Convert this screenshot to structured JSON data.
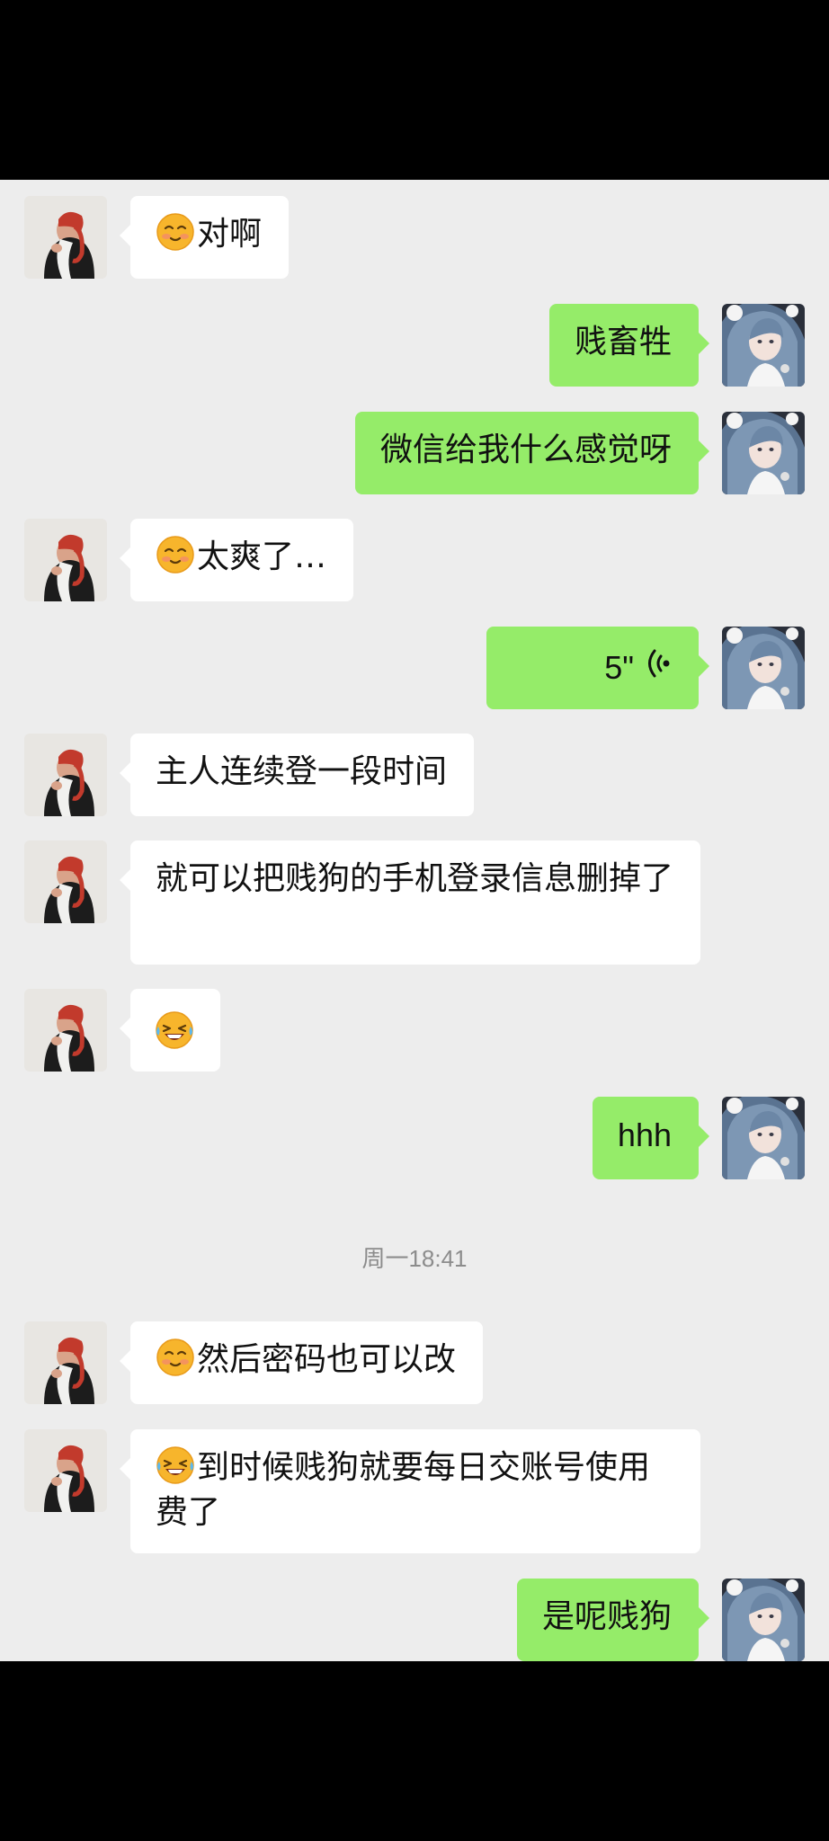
{
  "messages": [
    {
      "id": "m1",
      "side": "in",
      "emoji": "smile",
      "text": "对啊"
    },
    {
      "id": "m2",
      "side": "out",
      "text": "贱畜牲"
    },
    {
      "id": "m3",
      "side": "out",
      "text": "微信给我什么感觉呀"
    },
    {
      "id": "m4",
      "side": "in",
      "emoji": "smile",
      "text": "太爽了…"
    },
    {
      "id": "m5",
      "side": "out",
      "voice_duration": "5\""
    },
    {
      "id": "m6",
      "side": "in",
      "text": "主人连续登一段时间"
    },
    {
      "id": "m7",
      "side": "in",
      "text": "就可以把贱狗的手机登录信息删掉了"
    },
    {
      "id": "m8",
      "side": "in",
      "emoji": "tears-of-joy",
      "text": ""
    },
    {
      "id": "m9",
      "side": "out",
      "text": "hhh"
    },
    {
      "id": "m10",
      "side": "in",
      "emoji": "smile",
      "text": "然后密码也可以改"
    },
    {
      "id": "m11",
      "side": "in",
      "emoji": "tears-of-joy",
      "text": "到时候贱狗就要每日交账号使用费了"
    },
    {
      "id": "m12",
      "side": "out",
      "text": "是呢贱狗"
    }
  ],
  "timestamp": "周一18:41",
  "icons": {
    "voice": "voice-wave-icon",
    "smile": "smile-emoji-icon",
    "laugh": "tears-of-joy-emoji-icon"
  },
  "colors": {
    "chat_bg": "#ededed",
    "bubble_in": "#ffffff",
    "bubble_out": "#95ec69",
    "status_bar": "#000000"
  }
}
